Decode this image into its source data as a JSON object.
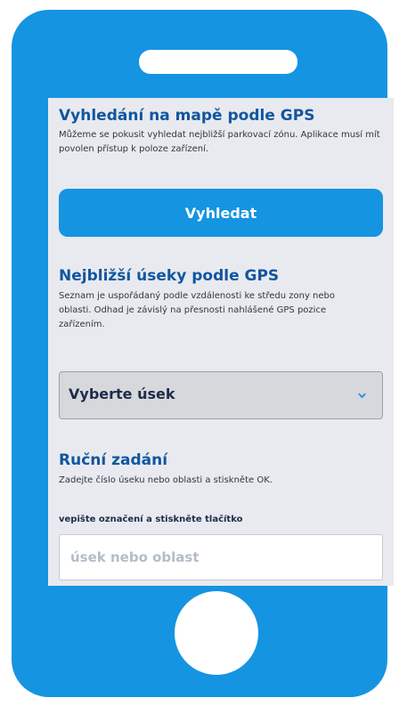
{
  "colors": {
    "phone_body": "#1594e2",
    "screen_background": "#e8eaef",
    "heading_text": "#11569f",
    "body_text": "#2f3642",
    "primary_button": "#1594e2",
    "select_background": "#d7d8dc"
  },
  "gps_search": {
    "title": "Vyhledání na mapě podle GPS",
    "description": "Můžeme se pokusit vyhledat nejbližší parkovací zónu. Aplikace musí mít povolen přístup k poloze zařízení.",
    "button_label": "Vyhledat"
  },
  "nearest_sections": {
    "title": "Nejbližší úseky podle GPS",
    "description": "Seznam je uspořádaný podle vzdálenosti ke středu zony nebo oblasti. Odhad je závislý na přesnosti nahlášené GPS pozice zařízením.",
    "select_value": "Vyberte úsek",
    "select_icon": "chevron-down-icon"
  },
  "manual_entry": {
    "title": "Ruční zadání",
    "description": "Zadejte číslo úseku nebo oblasti a stiskněte OK.",
    "input_label": "vepište označení a stiskněte tlačítko",
    "input_placeholder": "úsek nebo oblast",
    "input_value": ""
  }
}
